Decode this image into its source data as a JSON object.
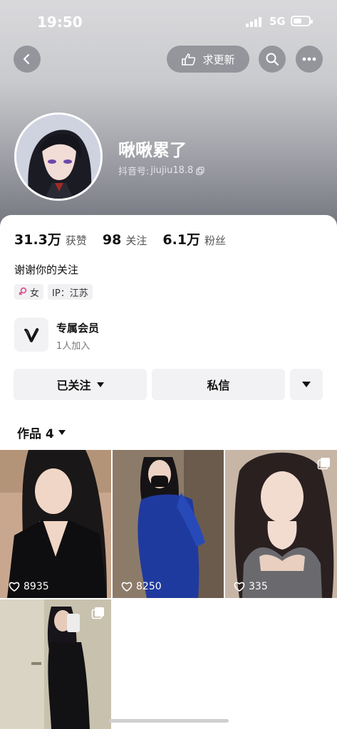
{
  "status_bar": {
    "time": "19:50",
    "network": "5G",
    "battery_level": 0.55
  },
  "top_actions": {
    "request_update_label": "求更新"
  },
  "profile": {
    "name": "啾啾累了",
    "id_label": "抖音号:",
    "id_value": "jiujiu18.8",
    "bio": "谢谢你的关注",
    "tags": [
      {
        "icon": "female-icon",
        "label": "女"
      },
      {
        "label": "IP：江苏"
      }
    ]
  },
  "stats": [
    {
      "value": "31.3万",
      "label": "获赞"
    },
    {
      "value": "98",
      "label": "关注"
    },
    {
      "value": "6.1万",
      "label": "粉丝"
    }
  ],
  "membership": {
    "title": "专属会员",
    "subtitle": "1人加入",
    "icon": "v-logo-icon"
  },
  "actions": {
    "follow_label": "已关注",
    "message_label": "私信"
  },
  "works": {
    "label": "作品 4"
  },
  "posts": [
    {
      "likes": "8935",
      "multi": false
    },
    {
      "likes": "8250",
      "multi": false
    },
    {
      "likes": "335",
      "multi": true
    },
    {
      "likes": "",
      "multi": true
    }
  ],
  "colors": {
    "accent_female": "#e0468c",
    "hero_top": "#d9d9dc",
    "hero_bottom": "#6f717a"
  }
}
